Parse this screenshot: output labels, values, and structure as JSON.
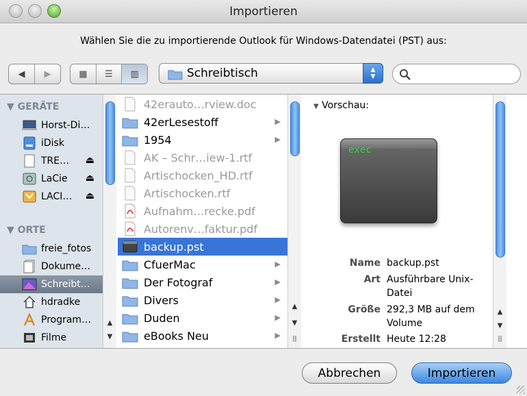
{
  "window": {
    "title": "Importieren"
  },
  "instruction": "Wählen Sie die zu importierende Outlook für Windows-Datendatei (PST) aus:",
  "toolbar": {
    "nav_back": "◀",
    "nav_forward": "▶",
    "view_icons": "▦",
    "view_list": "☰",
    "view_columns": "▥",
    "location": "Schreibtisch",
    "search_placeholder": ""
  },
  "sidebar": {
    "devices_label": "GERÄTE",
    "places_label": "ORTE",
    "devices": [
      {
        "label": "Horst-Di…",
        "icon": "computer-icon",
        "eject": false
      },
      {
        "label": "iDisk",
        "icon": "idisk-icon",
        "eject": false
      },
      {
        "label": "TRE…",
        "icon": "drive-icon",
        "eject": true
      },
      {
        "label": "LaCie",
        "icon": "external-drive-icon",
        "eject": true
      },
      {
        "label": "LACI…",
        "icon": "external-drive-icon",
        "eject": true
      }
    ],
    "places": [
      {
        "label": "freie_fotos",
        "icon": "folder-icon"
      },
      {
        "label": "Dokume…",
        "icon": "documents-icon"
      },
      {
        "label": "Schreibt…",
        "icon": "desktop-icon",
        "selected": true
      },
      {
        "label": "hdradke",
        "icon": "home-icon"
      },
      {
        "label": "Program…",
        "icon": "applications-icon"
      },
      {
        "label": "Filme",
        "icon": "movies-icon"
      }
    ]
  },
  "files": [
    {
      "label": "42erauto…rview.doc",
      "type": "doc",
      "dim": true,
      "folder": false
    },
    {
      "label": "42erLesestoff",
      "type": "folder",
      "dim": false,
      "folder": true
    },
    {
      "label": "1954",
      "type": "folder",
      "dim": false,
      "folder": true
    },
    {
      "label": "AK – Schr…iew-1.rtf",
      "type": "doc",
      "dim": true,
      "folder": false
    },
    {
      "label": "Artischocken_HD.rtf",
      "type": "doc",
      "dim": true,
      "folder": false
    },
    {
      "label": "Artischocken.rtf",
      "type": "doc",
      "dim": true,
      "folder": false
    },
    {
      "label": "Aufnahm…recke.pdf",
      "type": "pdf",
      "dim": true,
      "folder": false
    },
    {
      "label": "Autorenv…faktur.pdf",
      "type": "pdf",
      "dim": true,
      "folder": false
    },
    {
      "label": "backup.pst",
      "type": "pst",
      "dim": false,
      "folder": false,
      "selected": true
    },
    {
      "label": "CfuerMac",
      "type": "folder",
      "dim": false,
      "folder": true
    },
    {
      "label": "Der Fotograf",
      "type": "folder",
      "dim": false,
      "folder": true
    },
    {
      "label": "Divers",
      "type": "folder",
      "dim": false,
      "folder": true
    },
    {
      "label": "Duden",
      "type": "folder",
      "dim": false,
      "folder": true
    },
    {
      "label": "eBooks Neu",
      "type": "folder",
      "dim": false,
      "folder": true
    }
  ],
  "preview": {
    "heading": "Vorschau:",
    "icon_text": "exec",
    "fields": [
      {
        "key": "Name",
        "value": "backup.pst"
      },
      {
        "key": "Art",
        "value": "Ausführbare Unix-Datei"
      },
      {
        "key": "Größe",
        "value": "292,3 MB auf dem Volume"
      },
      {
        "key": "Erstellt",
        "value": "Heute 12:28"
      }
    ]
  },
  "buttons": {
    "cancel": "Abbrechen",
    "import": "Importieren"
  },
  "colors": {
    "selection": "#3875d7",
    "sidebar_bg": "#dde4ec",
    "default_button": "#3d87e0"
  }
}
